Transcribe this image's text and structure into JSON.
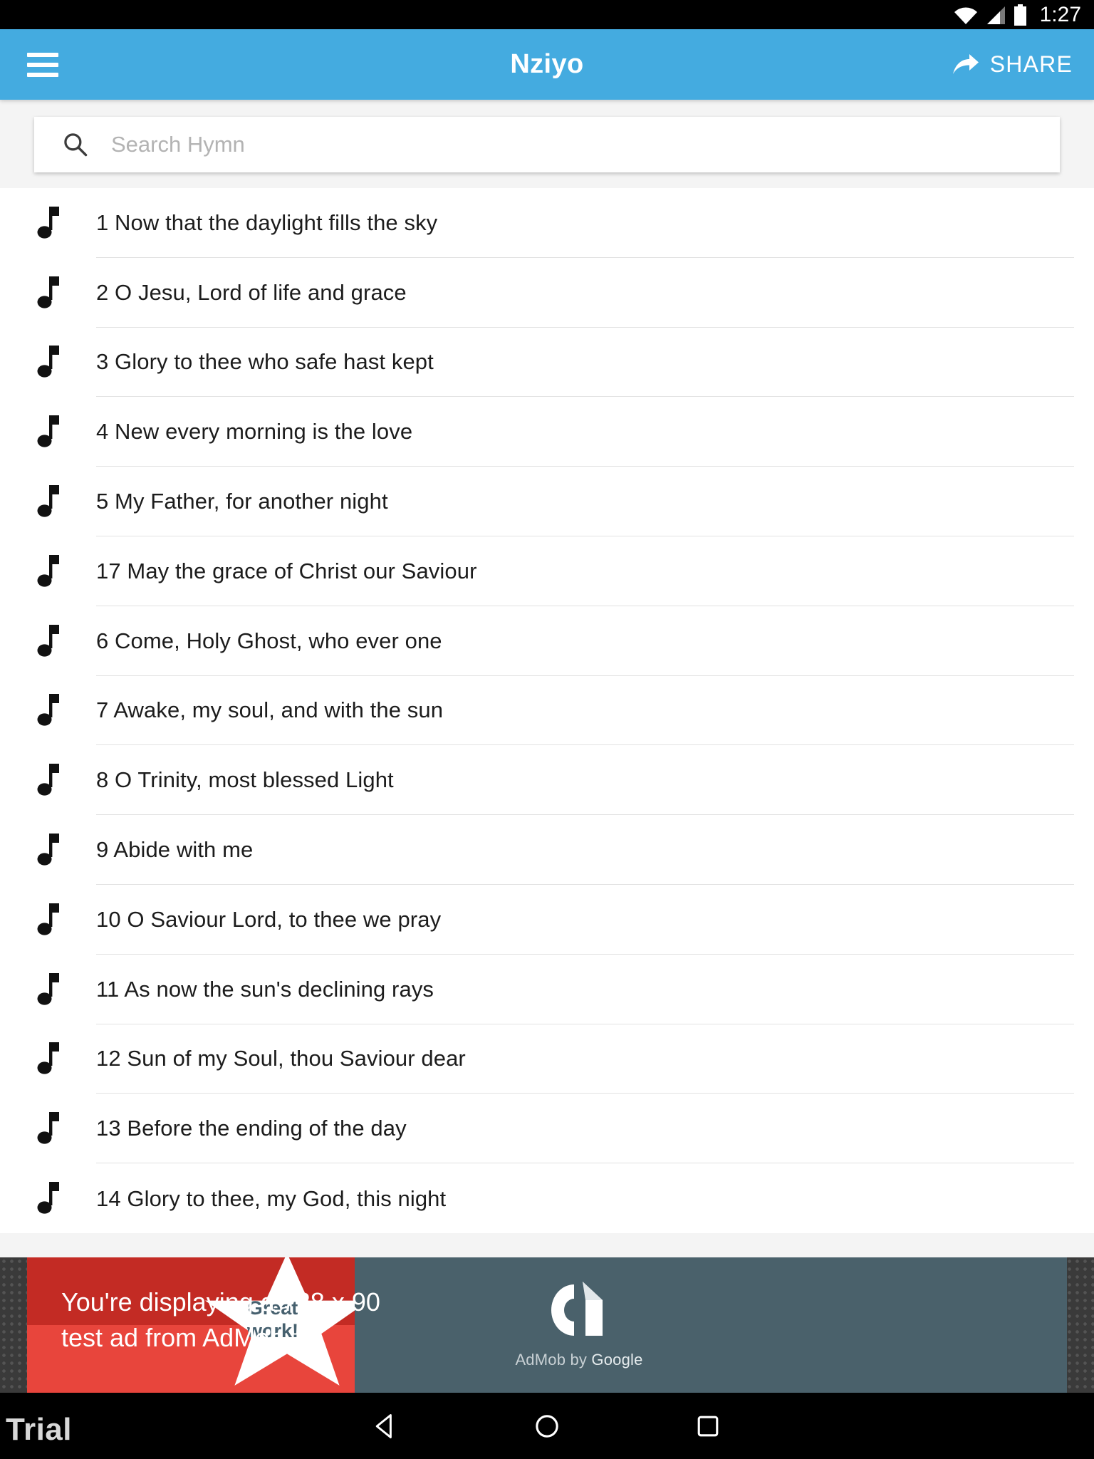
{
  "status_bar": {
    "time": "1:27",
    "icons": [
      "wifi-icon",
      "cellular-signal-icon",
      "battery-icon"
    ]
  },
  "app_bar": {
    "title": "Nziyo",
    "menu_icon": "hamburger-menu-icon",
    "share_label": "SHARE",
    "share_icon": "share-arrow-icon",
    "background_color": "#44abe0"
  },
  "search": {
    "placeholder": "Search Hymn",
    "value": "",
    "icon": "search-icon"
  },
  "hymn_list": {
    "row_icon": "music-note-icon",
    "items": [
      {
        "title": "1 Now that the daylight fills the sky"
      },
      {
        "title": "2 O Jesu, Lord of life and grace"
      },
      {
        "title": "3 Glory to thee who safe hast kept"
      },
      {
        "title": "4 New every morning is the love"
      },
      {
        "title": "5 My Father, for another night"
      },
      {
        "title": "17 May the grace of Christ our Saviour"
      },
      {
        "title": "6 Come, Holy Ghost, who ever one"
      },
      {
        "title": "7 Awake, my soul, and with the sun"
      },
      {
        "title": "8 O Trinity, most blessed Light"
      },
      {
        "title": "9 Abide with me"
      },
      {
        "title": "10 O Saviour Lord, to thee we pray"
      },
      {
        "title": "11 As now the sun's declining rays"
      },
      {
        "title": "12 Sun of my Soul, thou Saviour dear"
      },
      {
        "title": "13 Before the ending of the day"
      },
      {
        "title": "14 Glory to thee, my God, this night"
      }
    ]
  },
  "ad_banner": {
    "badge_line1": "Great",
    "badge_line2": "work!",
    "message_line1": "You're displaying a 728 x 90",
    "message_line2": "test ad from AdMob.",
    "brand_prefix": "AdMob by ",
    "brand_suffix": "Google",
    "logo_icon": "admob-logo-icon",
    "background_color": "#4a616b",
    "accent_color": "#c32b24"
  },
  "nav_bar": {
    "back_icon": "back-triangle-icon",
    "home_icon": "home-circle-icon",
    "recents_icon": "recents-square-icon"
  },
  "watermark": {
    "text": "Trial"
  }
}
